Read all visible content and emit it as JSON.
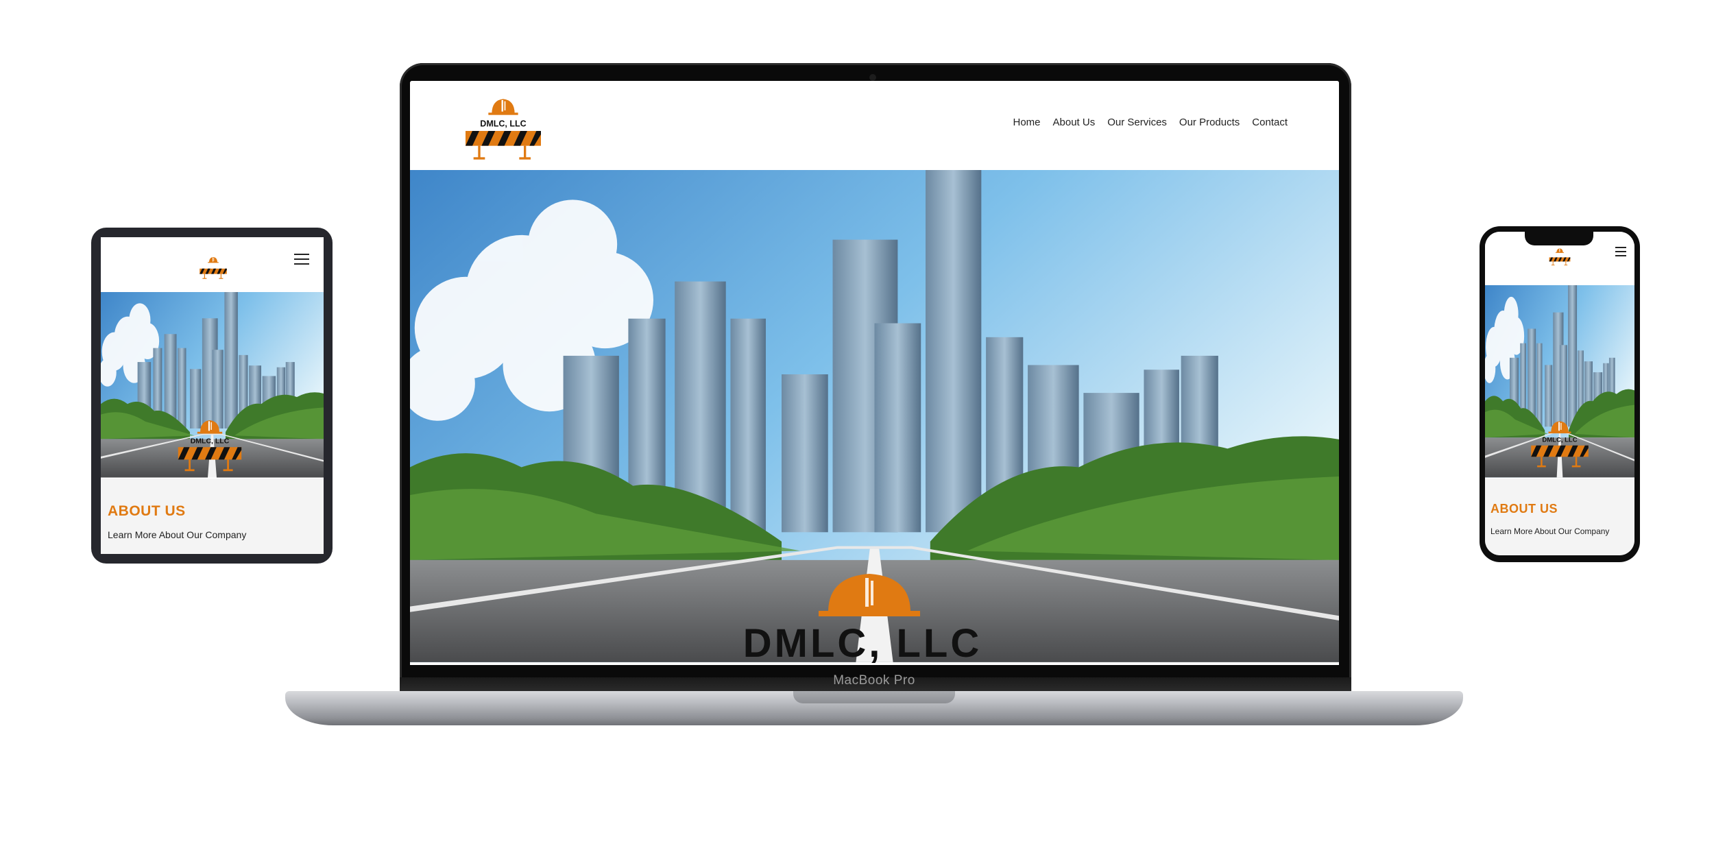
{
  "brand": {
    "name": "DMLC, LLC",
    "accent": "#e07a12",
    "text_dark": "#111111"
  },
  "laptop": {
    "model_label": "MacBook Pro",
    "nav": {
      "items": [
        "Home",
        "About Us",
        "Our Services",
        "Our Products",
        "Contact"
      ]
    },
    "hero": {
      "logo_text": "DMLC, LLC"
    }
  },
  "tablet": {
    "menu_icon": "hamburger-icon",
    "about": {
      "title": "ABOUT US",
      "subtitle": "Learn More About Our Company"
    }
  },
  "phone": {
    "menu_icon": "hamburger-icon",
    "about": {
      "title": "ABOUT US",
      "subtitle": "Learn More About Our Company"
    }
  }
}
